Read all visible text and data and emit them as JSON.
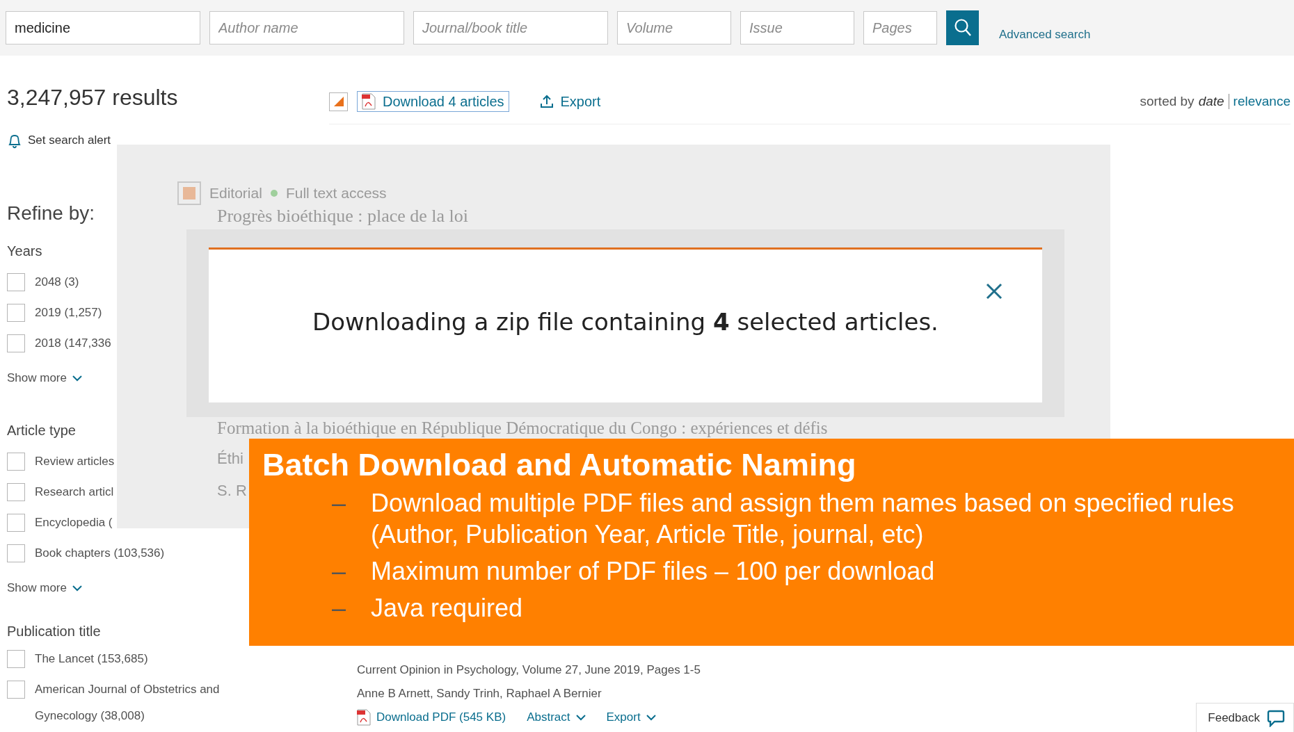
{
  "search": {
    "fields": [
      {
        "value": "medicine"
      },
      {
        "placeholder": "Author name"
      },
      {
        "placeholder": "Journal/book title"
      },
      {
        "placeholder": "Volume"
      },
      {
        "placeholder": "Issue"
      },
      {
        "placeholder": "Pages"
      }
    ],
    "advanced_link": "Advanced search"
  },
  "results": {
    "count": "3,247,957 results",
    "alert": "Set search alert"
  },
  "toolbar": {
    "select_all_partial": true,
    "download": "Download 4 articles",
    "export": "Export",
    "sort_label": "sorted by",
    "sort_options": [
      {
        "label": "date",
        "selected": true
      },
      {
        "label": "relevance",
        "selected": false
      }
    ]
  },
  "refine": {
    "title": "Refine by:",
    "groups": [
      {
        "title": "Years",
        "items": [
          {
            "label": "2048 (3)",
            "checked": false
          },
          {
            "label": "2019 (1,257)",
            "checked": false
          },
          {
            "label": "2018 (147,336",
            "checked": false
          }
        ],
        "show_more": "Show more"
      },
      {
        "title": "Article type",
        "items": [
          {
            "label": "Review articles",
            "checked": false
          },
          {
            "label": "Research articl",
            "checked": false
          },
          {
            "label": "Encyclopedia (",
            "checked": false
          },
          {
            "label": "Book chapters (103,536)",
            "checked": false
          }
        ],
        "show_more": "Show more"
      },
      {
        "title": "Publication title",
        "items": [
          {
            "label": "The Lancet (153,685)",
            "checked": false
          },
          {
            "label": "American Journal of Obstetrics and Gynecology (38,008)",
            "checked": false
          }
        ]
      }
    ]
  },
  "background": {
    "checked": true,
    "type": "Editorial",
    "access": "Full text access",
    "title": "Progrès bioéthique : place de la loi",
    "next_title": "Formation à la bioéthique en République Démocratique du Congo : expériences et défis",
    "fragments": [
      "Éthi",
      "S. R"
    ]
  },
  "modal": {
    "message": "Downloading a zip file containing **4** selected articles."
  },
  "callout": {
    "title": "Batch Download and Automatic Naming",
    "bullets": [
      {
        "marker": "–",
        "text": "Download multiple PDF files and assign them names based on specified rules (Author, Publication Year, Article Title, journal, etc)"
      },
      {
        "marker": "–",
        "text": "Maximum number of PDF files – 100 per download"
      },
      {
        "marker": "–",
        "text": "Java required"
      }
    ]
  },
  "result": {
    "source": "Current Opinion in Psychology, Volume 27, June 2019, Pages 1-5",
    "authors": "Anne B Arnett, Sandy Trinh, Raphael A Bernier",
    "actions": [
      {
        "kind": "pdf",
        "label": "Download PDF (545 KB)"
      },
      {
        "kind": "dropdown",
        "label": "Abstract"
      },
      {
        "kind": "dropdown",
        "label": "Export"
      }
    ]
  },
  "feedback": "Feedback"
}
